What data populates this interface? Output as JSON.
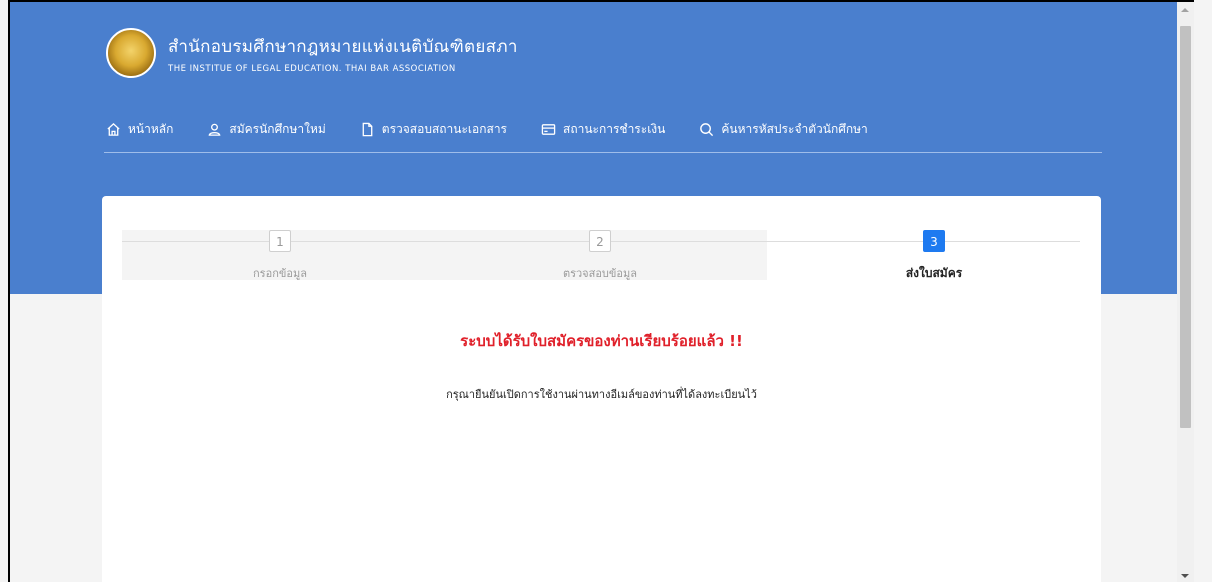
{
  "brand": {
    "title_th": "สำนักอบรมศึกษากฎหมายแห่งเนติบัณฑิตยสภา",
    "title_en": "THE INSTITUE OF LEGAL EDUCATION. THAI BAR ASSOCIATION",
    "logo_icon": "seal-emblem"
  },
  "nav": {
    "items": [
      {
        "label": "หน้าหลัก",
        "icon": "home-icon"
      },
      {
        "label": "สมัครนักศึกษาใหม่",
        "icon": "user-icon"
      },
      {
        "label": "ตรวจสอบสถานะเอกสาร",
        "icon": "document-icon"
      },
      {
        "label": "สถานะการชำระเงิน",
        "icon": "credit-card-icon"
      },
      {
        "label": "ค้นหารหัสประจำตัวนักศึกษา",
        "icon": "search-icon"
      }
    ]
  },
  "steps": [
    {
      "num": "1",
      "label": "กรอกข้อมูล",
      "active": false
    },
    {
      "num": "2",
      "label": "ตรวจสอบข้อมูล",
      "active": false
    },
    {
      "num": "3",
      "label": "ส่งใบสมัคร",
      "active": true
    }
  ],
  "result": {
    "message": "ระบบได้รับใบสมัครของท่านเรียบร้อยแล้ว !!",
    "note": "กรุณายืนยันเปิดการใช้งานผ่านทางอีเมล์ของท่านที่ได้ลงทะเบียนไว้"
  },
  "colors": {
    "header_bg": "#4a7fce",
    "active_step": "#1e7af0",
    "success_text": "#e0202a"
  }
}
